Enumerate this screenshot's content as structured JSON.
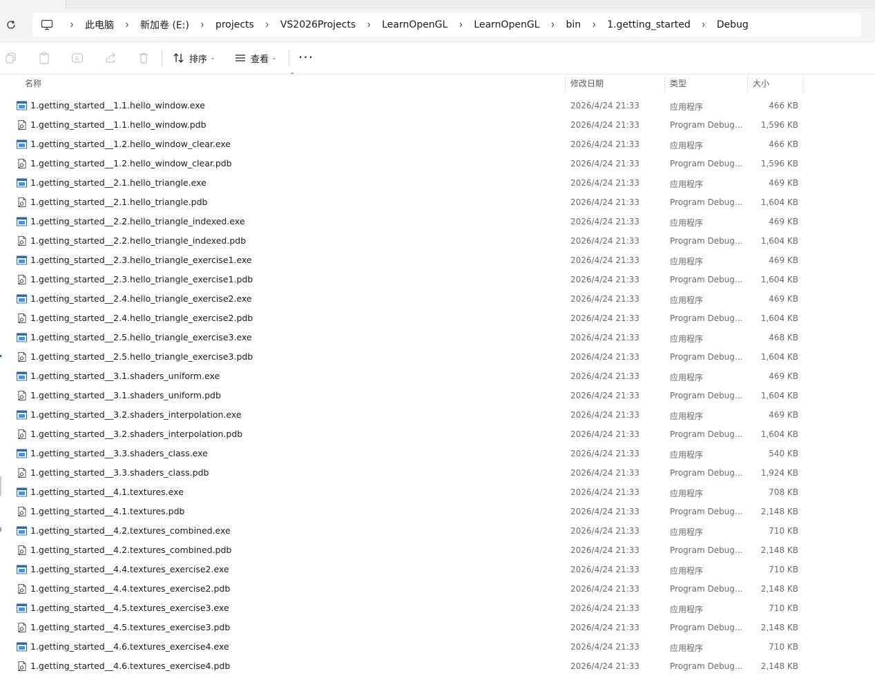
{
  "breadcrumb": [
    "此电脑",
    "新加卷 (E:)",
    "projects",
    "VS2026Projects",
    "LearnOpenGL",
    "LearnOpenGL",
    "bin",
    "1.getting_started",
    "Debug"
  ],
  "toolbar": {
    "sort_label": "排序",
    "view_label": "查看",
    "more_label": "···"
  },
  "columns": {
    "name": "名称",
    "modified": "修改日期",
    "type": "类型",
    "size": "大小"
  },
  "files": [
    {
      "name": "1.getting_started__1.1.hello_window.exe",
      "date": "2026/4/24 21:33",
      "type": "应用程序",
      "size": "466 KB",
      "kind": "exe"
    },
    {
      "name": "1.getting_started__1.1.hello_window.pdb",
      "date": "2026/4/24 21:33",
      "type": "Program Debug...",
      "size": "1,596 KB",
      "kind": "pdb"
    },
    {
      "name": "1.getting_started__1.2.hello_window_clear.exe",
      "date": "2026/4/24 21:33",
      "type": "应用程序",
      "size": "466 KB",
      "kind": "exe"
    },
    {
      "name": "1.getting_started__1.2.hello_window_clear.pdb",
      "date": "2026/4/24 21:33",
      "type": "Program Debug...",
      "size": "1,596 KB",
      "kind": "pdb"
    },
    {
      "name": "1.getting_started__2.1.hello_triangle.exe",
      "date": "2026/4/24 21:33",
      "type": "应用程序",
      "size": "469 KB",
      "kind": "exe"
    },
    {
      "name": "1.getting_started__2.1.hello_triangle.pdb",
      "date": "2026/4/24 21:33",
      "type": "Program Debug...",
      "size": "1,604 KB",
      "kind": "pdb"
    },
    {
      "name": "1.getting_started__2.2.hello_triangle_indexed.exe",
      "date": "2026/4/24 21:33",
      "type": "应用程序",
      "size": "469 KB",
      "kind": "exe"
    },
    {
      "name": "1.getting_started__2.2.hello_triangle_indexed.pdb",
      "date": "2026/4/24 21:33",
      "type": "Program Debug...",
      "size": "1,604 KB",
      "kind": "pdb"
    },
    {
      "name": "1.getting_started__2.3.hello_triangle_exercise1.exe",
      "date": "2026/4/24 21:33",
      "type": "应用程序",
      "size": "469 KB",
      "kind": "exe"
    },
    {
      "name": "1.getting_started__2.3.hello_triangle_exercise1.pdb",
      "date": "2026/4/24 21:33",
      "type": "Program Debug...",
      "size": "1,604 KB",
      "kind": "pdb"
    },
    {
      "name": "1.getting_started__2.4.hello_triangle_exercise2.exe",
      "date": "2026/4/24 21:33",
      "type": "应用程序",
      "size": "469 KB",
      "kind": "exe"
    },
    {
      "name": "1.getting_started__2.4.hello_triangle_exercise2.pdb",
      "date": "2026/4/24 21:33",
      "type": "Program Debug...",
      "size": "1,604 KB",
      "kind": "pdb"
    },
    {
      "name": "1.getting_started__2.5.hello_triangle_exercise3.exe",
      "date": "2026/4/24 21:33",
      "type": "应用程序",
      "size": "468 KB",
      "kind": "exe"
    },
    {
      "name": "1.getting_started__2.5.hello_triangle_exercise3.pdb",
      "date": "2026/4/24 21:33",
      "type": "Program Debug...",
      "size": "1,604 KB",
      "kind": "pdb"
    },
    {
      "name": "1.getting_started__3.1.shaders_uniform.exe",
      "date": "2026/4/24 21:33",
      "type": "应用程序",
      "size": "469 KB",
      "kind": "exe"
    },
    {
      "name": "1.getting_started__3.1.shaders_uniform.pdb",
      "date": "2026/4/24 21:33",
      "type": "Program Debug...",
      "size": "1,604 KB",
      "kind": "pdb"
    },
    {
      "name": "1.getting_started__3.2.shaders_interpolation.exe",
      "date": "2026/4/24 21:33",
      "type": "应用程序",
      "size": "469 KB",
      "kind": "exe"
    },
    {
      "name": "1.getting_started__3.2.shaders_interpolation.pdb",
      "date": "2026/4/24 21:33",
      "type": "Program Debug...",
      "size": "1,604 KB",
      "kind": "pdb"
    },
    {
      "name": "1.getting_started__3.3.shaders_class.exe",
      "date": "2026/4/24 21:33",
      "type": "应用程序",
      "size": "540 KB",
      "kind": "exe"
    },
    {
      "name": "1.getting_started__3.3.shaders_class.pdb",
      "date": "2026/4/24 21:33",
      "type": "Program Debug...",
      "size": "1,924 KB",
      "kind": "pdb"
    },
    {
      "name": "1.getting_started__4.1.textures.exe",
      "date": "2026/4/24 21:33",
      "type": "应用程序",
      "size": "708 KB",
      "kind": "exe"
    },
    {
      "name": "1.getting_started__4.1.textures.pdb",
      "date": "2026/4/24 21:33",
      "type": "Program Debug...",
      "size": "2,148 KB",
      "kind": "pdb"
    },
    {
      "name": "1.getting_started__4.2.textures_combined.exe",
      "date": "2026/4/24 21:33",
      "type": "应用程序",
      "size": "710 KB",
      "kind": "exe"
    },
    {
      "name": "1.getting_started__4.2.textures_combined.pdb",
      "date": "2026/4/24 21:33",
      "type": "Program Debug...",
      "size": "2,148 KB",
      "kind": "pdb"
    },
    {
      "name": "1.getting_started__4.4.textures_exercise2.exe",
      "date": "2026/4/24 21:33",
      "type": "应用程序",
      "size": "710 KB",
      "kind": "exe"
    },
    {
      "name": "1.getting_started__4.4.textures_exercise2.pdb",
      "date": "2026/4/24 21:33",
      "type": "Program Debug...",
      "size": "2,148 KB",
      "kind": "pdb"
    },
    {
      "name": "1.getting_started__4.5.textures_exercise3.exe",
      "date": "2026/4/24 21:33",
      "type": "应用程序",
      "size": "710 KB",
      "kind": "exe"
    },
    {
      "name": "1.getting_started__4.5.textures_exercise3.pdb",
      "date": "2026/4/24 21:33",
      "type": "Program Debug...",
      "size": "2,148 KB",
      "kind": "pdb"
    },
    {
      "name": "1.getting_started__4.6.textures_exercise4.exe",
      "date": "2026/4/24 21:33",
      "type": "应用程序",
      "size": "710 KB",
      "kind": "exe"
    },
    {
      "name": "1.getting_started__4.6.textures_exercise4.pdb",
      "date": "2026/4/24 21:33",
      "type": "Program Debug...",
      "size": "2,148 KB",
      "kind": "pdb"
    }
  ]
}
